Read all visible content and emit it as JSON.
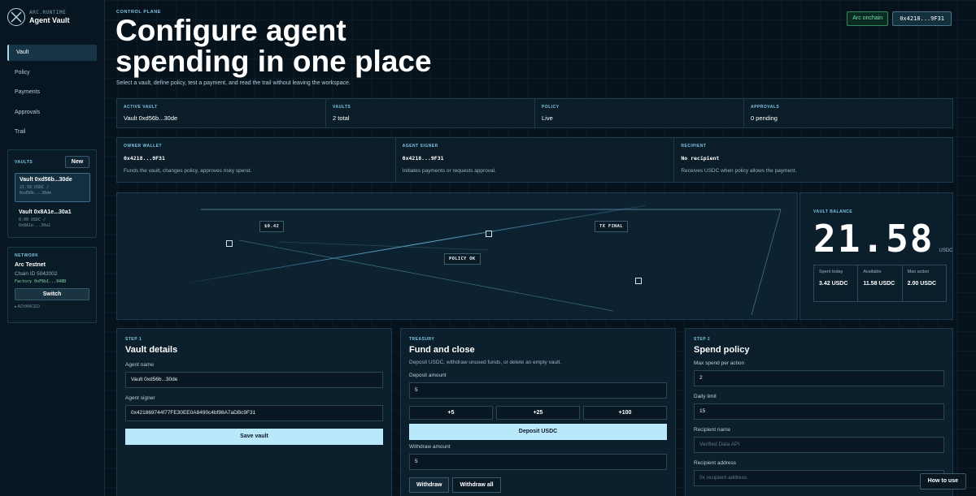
{
  "brand": {
    "small": "ARC.RUNTIME",
    "title": "Agent Vault"
  },
  "nav": [
    {
      "label": "Vault"
    },
    {
      "label": "Policy"
    },
    {
      "label": "Payments"
    },
    {
      "label": "Approvals"
    },
    {
      "label": "Trail"
    }
  ],
  "vaults_box": {
    "label": "VAULTS",
    "new_label": "New",
    "items": [
      {
        "name": "Vault 0xd56b...30de",
        "meta1": "21.58 USDC /",
        "meta2": "0xd56b...30de"
      },
      {
        "name": "Vault 0x8A1e...30a1",
        "meta1": "0.00 USDC /",
        "meta2": "0x8A1e...30a1"
      }
    ]
  },
  "network": {
    "label": "NETWORK",
    "name": "Arc Testnet",
    "chain": "Chain ID 5042002",
    "factory": "Factory 0xF6b1...948D",
    "switch_label": "Switch",
    "advanced": "▸ ADVANCED"
  },
  "header": {
    "eyebrow": "CONTROL PLANE",
    "title": "Configure agent spending in one place",
    "subtitle": "Select a vault, define policy, test a payment, and read the trail without leaving the workspace.",
    "onchain": "Arc onchain",
    "address": "0x4218...9F31"
  },
  "stats": [
    {
      "label": "ACTIVE VAULT",
      "value": "Vault 0xd56b...30de"
    },
    {
      "label": "VAULTS",
      "value": "2 total"
    },
    {
      "label": "POLICY",
      "value": "Live"
    },
    {
      "label": "APPROVALS",
      "value": "0 pending"
    }
  ],
  "wallets": [
    {
      "label": "OWNER WALLET",
      "address": "0x4218...9F31",
      "desc": "Funds the vault, changes policy, approves risky spend."
    },
    {
      "label": "AGENT SIGNER",
      "address": "0x4218...9F31",
      "desc": "Initiates payments or requests approval."
    },
    {
      "label": "RECIPIENT",
      "address": "No recipient",
      "desc": "Receives USDC when policy allows the payment."
    }
  ],
  "visual": {
    "tag_amount": "$0.42",
    "tag_policy": "POLICY OK",
    "tag_final": "TX FINAL"
  },
  "balance": {
    "label": "VAULT BALANCE",
    "amount": "21.58",
    "unit": "USDC",
    "spent_label": "Spent today",
    "spent_value": "3.42 USDC",
    "available_label": "Available",
    "available_value": "11.58 USDC",
    "max_label": "Max action",
    "max_value": "2.00 USDC"
  },
  "vault_details": {
    "step": "STEP 1",
    "title": "Vault details",
    "name_label": "Agent name",
    "name_value": "Vault 0xd56b...30de",
    "signer_label": "Agent signer",
    "signer_value": "0x421869744f77FE30EE0A8490c4bf98A7aDBc9F31",
    "save_label": "Save vault"
  },
  "treasury": {
    "step": "TREASURY",
    "title": "Fund and close",
    "desc": "Deposit USDC, withdraw unused funds, or delete an empty vault.",
    "deposit_label": "Deposit amount",
    "deposit_value": "5",
    "quick": [
      "+5",
      "+25",
      "+100"
    ],
    "deposit_btn": "Deposit USDC",
    "withdraw_label": "Withdraw amount",
    "withdraw_value": "5",
    "withdraw_btn": "Withdraw",
    "withdraw_all_btn": "Withdraw all"
  },
  "policy": {
    "step": "STEP 2",
    "title": "Spend policy",
    "max_label": "Max spend per action",
    "max_value": "2",
    "daily_label": "Daily limit",
    "daily_value": "15",
    "rname_label": "Recipient name",
    "rname_placeholder": "Verified Data API",
    "raddr_label": "Recipient address",
    "raddr_placeholder": "0x recipient address"
  },
  "howto": "How to use"
}
